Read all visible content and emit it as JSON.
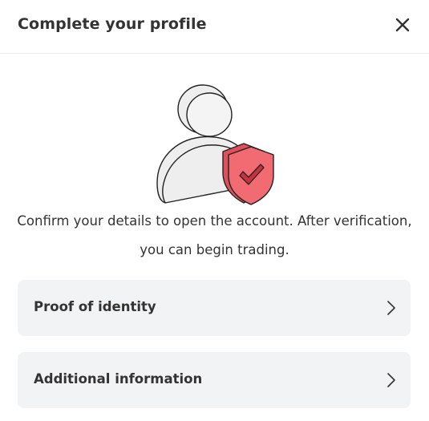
{
  "header": {
    "title": "Complete your profile",
    "close_icon": "close-icon"
  },
  "illustration": {
    "icon": "user-shield-check-icon",
    "colors": {
      "figure_fill": "#eeeeee",
      "figure_stroke": "#222222",
      "shield": "#f26b73",
      "shield_dark": "#e0505a",
      "check": "#c8323e"
    }
  },
  "description": {
    "line1": "Confirm your details to open the account. After verification,",
    "line2": "you can begin trading."
  },
  "options": [
    {
      "label": "Proof of identity",
      "icon": "chevron-right-icon"
    },
    {
      "label": "Additional information",
      "icon": "chevron-right-icon"
    }
  ],
  "colors": {
    "text": "#333333",
    "row_background": "#f2f3f5",
    "divider": "#ececec"
  }
}
